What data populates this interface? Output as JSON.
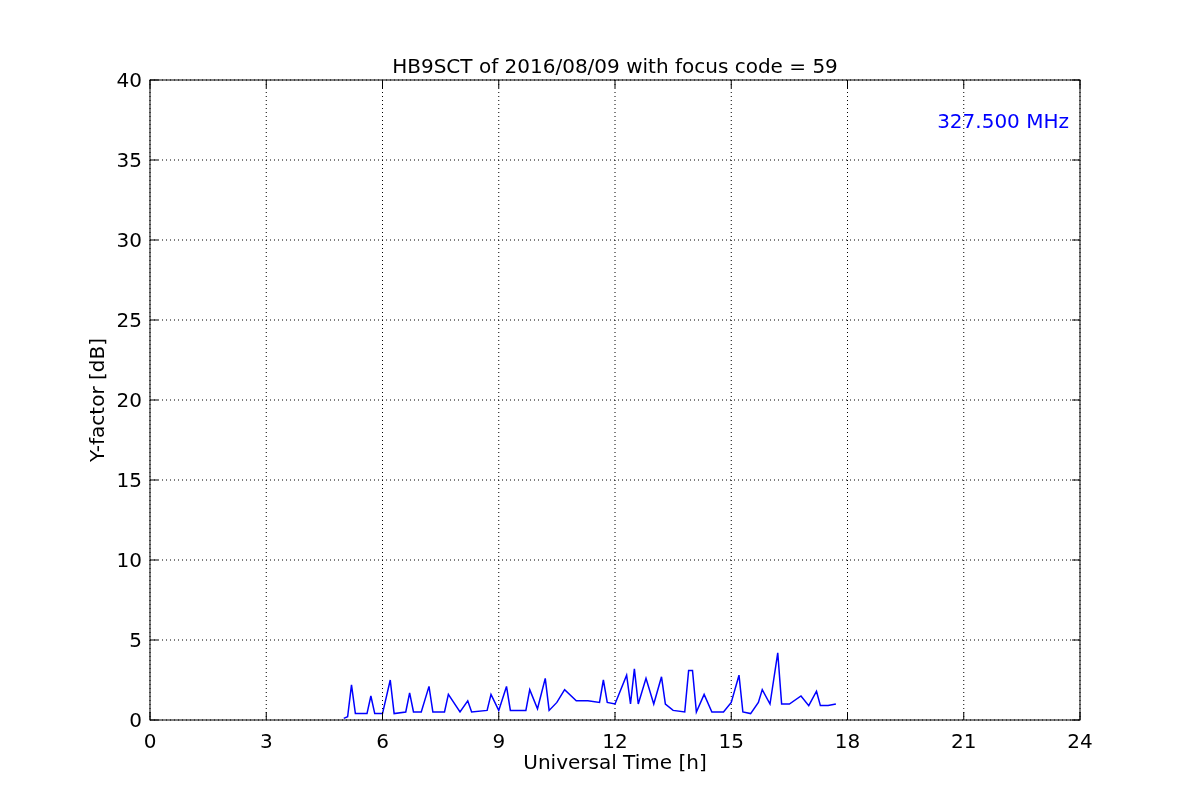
{
  "chart_data": {
    "type": "line",
    "title": "HB9SCT of 2016/08/09 with focus code = 59",
    "xlabel": "Universal Time [h]",
    "ylabel": "Y-factor [dB]",
    "x": [
      5.0,
      5.1,
      5.2,
      5.3,
      5.6,
      5.7,
      5.8,
      6.0,
      6.2,
      6.3,
      6.6,
      6.7,
      6.8,
      7.0,
      7.2,
      7.3,
      7.6,
      7.7,
      8.0,
      8.2,
      8.3,
      8.7,
      8.8,
      9.0,
      9.2,
      9.3,
      9.7,
      9.8,
      10.0,
      10.2,
      10.3,
      10.5,
      10.7,
      11.0,
      11.3,
      11.6,
      11.7,
      11.8,
      12.0,
      12.3,
      12.4,
      12.5,
      12.6,
      12.8,
      13.0,
      13.2,
      13.3,
      13.5,
      13.8,
      13.9,
      14.0,
      14.1,
      14.3,
      14.5,
      14.8,
      15.0,
      15.2,
      15.3,
      15.5,
      15.7,
      15.8,
      16.0,
      16.2,
      16.3,
      16.5,
      16.8,
      17.0,
      17.2,
      17.3,
      17.5,
      17.7
    ],
    "series": [
      {
        "color": "#0000ff",
        "values": [
          0.1,
          0.2,
          2.2,
          0.4,
          0.4,
          1.5,
          0.4,
          0.4,
          2.5,
          0.4,
          0.5,
          1.7,
          0.5,
          0.5,
          2.1,
          0.5,
          0.5,
          1.6,
          0.5,
          1.2,
          0.5,
          0.6,
          1.6,
          0.6,
          2.1,
          0.6,
          0.6,
          1.9,
          0.7,
          2.6,
          0.6,
          1.1,
          1.9,
          1.2,
          1.2,
          1.1,
          2.5,
          1.1,
          1.0,
          2.8,
          1.0,
          3.2,
          1.0,
          2.6,
          1.0,
          2.7,
          1.0,
          0.6,
          0.5,
          3.1,
          3.1,
          0.5,
          1.6,
          0.5,
          0.5,
          1.1,
          2.8,
          0.5,
          0.4,
          1.1,
          1.9,
          1.0,
          4.2,
          1.0,
          1.0,
          1.5,
          0.9,
          1.8,
          0.9,
          0.9,
          1.0
        ]
      }
    ],
    "grid": true,
    "xlim": [
      0,
      24
    ],
    "ylim": [
      0,
      40
    ],
    "xticks": [
      0,
      3,
      6,
      9,
      12,
      15,
      18,
      21,
      24
    ],
    "yticks": [
      0,
      5,
      10,
      15,
      20,
      25,
      30,
      35,
      40
    ],
    "annotations": [
      {
        "text": "327.500 MHz"
      }
    ]
  }
}
